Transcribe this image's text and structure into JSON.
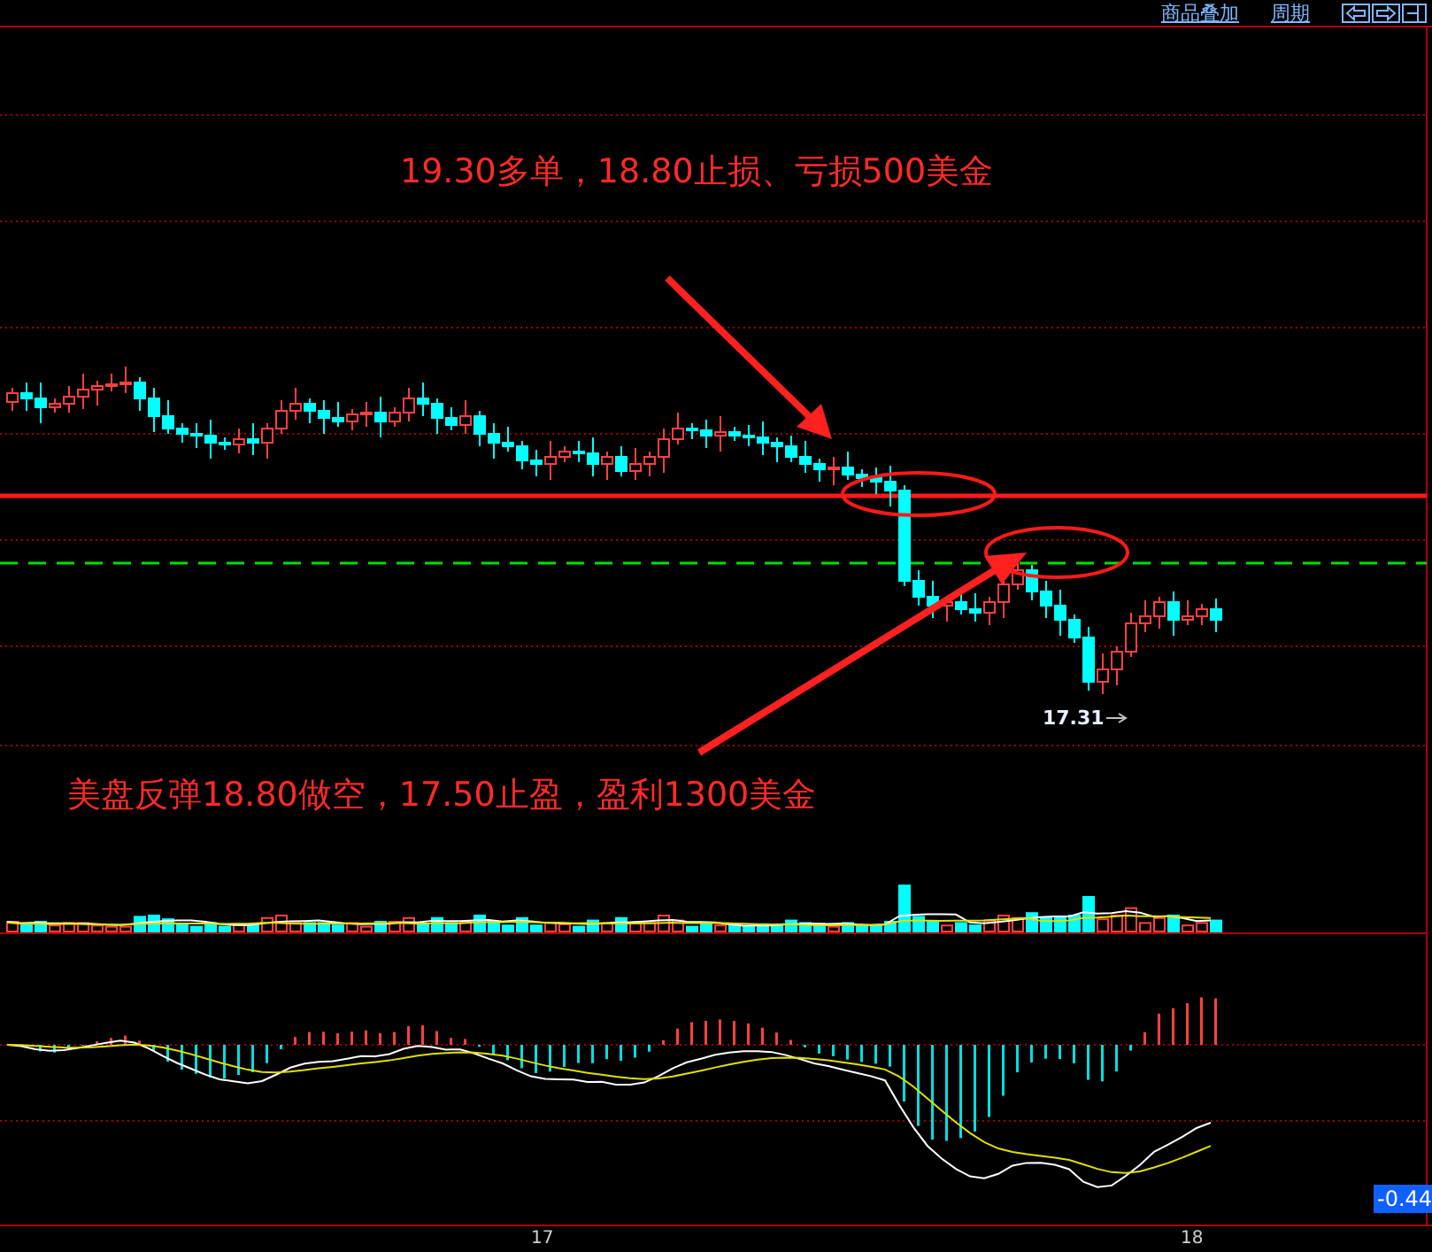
{
  "toolbar": {
    "links": [
      "商品叠加",
      "周期"
    ]
  },
  "annotations": [
    {
      "text": "19.30多单，18.80止损、亏损500美金"
    },
    {
      "text": "美盘反弹18.80做空，17.50止盈，盈利1300美金"
    }
  ],
  "price_marker": {
    "label": "17.31"
  },
  "indicator_value": "-0.44",
  "x_axis_labels": [
    "17",
    "18"
  ]
}
